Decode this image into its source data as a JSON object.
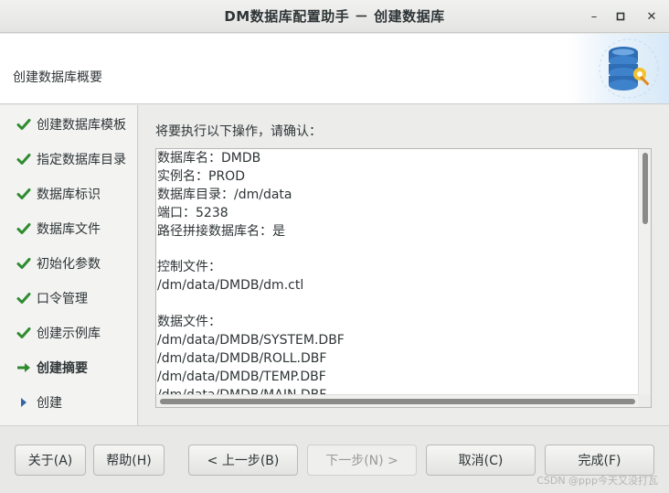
{
  "window": {
    "title": "DM数据库配置助手 － 创建数据库",
    "minimize_glyph": "–",
    "maximize_glyph": "▫",
    "close_glyph": "✕"
  },
  "header": {
    "title": "创建数据库概要"
  },
  "sidebar": {
    "steps": [
      {
        "label": "创建数据库模板",
        "state": "done"
      },
      {
        "label": "指定数据库目录",
        "state": "done"
      },
      {
        "label": "数据库标识",
        "state": "done"
      },
      {
        "label": "数据库文件",
        "state": "done"
      },
      {
        "label": "初始化参数",
        "state": "done"
      },
      {
        "label": "口令管理",
        "state": "done"
      },
      {
        "label": "创建示例库",
        "state": "done"
      },
      {
        "label": "创建摘要",
        "state": "current"
      },
      {
        "label": "创建",
        "state": "pending"
      }
    ]
  },
  "main": {
    "prompt": "将要执行以下操作，请确认：",
    "summary_lines": [
      "数据库名：DMDB",
      "实例名：PROD",
      "数据库目录：/dm/data",
      "端口：5238",
      "路径拼接数据库名：是",
      "",
      "控制文件：",
      "/dm/data/DMDB/dm.ctl",
      "",
      "数据文件：",
      "/dm/data/DMDB/SYSTEM.DBF",
      "/dm/data/DMDB/ROLL.DBF",
      "/dm/data/DMDB/TEMP.DBF",
      "/dm/data/DMDB/MAIN.DBF"
    ]
  },
  "footer": {
    "about_label": "关于(A)",
    "help_label": "帮助(H)",
    "prev_label": "< 上一步(B)",
    "next_label": "下一步(N) >",
    "cancel_label": "取消(C)",
    "finish_label": "完成(F)"
  },
  "watermark": "CSDN @ppp今天又没打瓦",
  "colors": {
    "check": "#2e8b2e",
    "current_arrow": "#2e8b2e",
    "pending_arrow": "#3465a4"
  },
  "icons": {
    "done": "check-icon",
    "current": "arrow-right-icon",
    "pending": "triangle-right-icon",
    "header": "database-settings-icon"
  }
}
